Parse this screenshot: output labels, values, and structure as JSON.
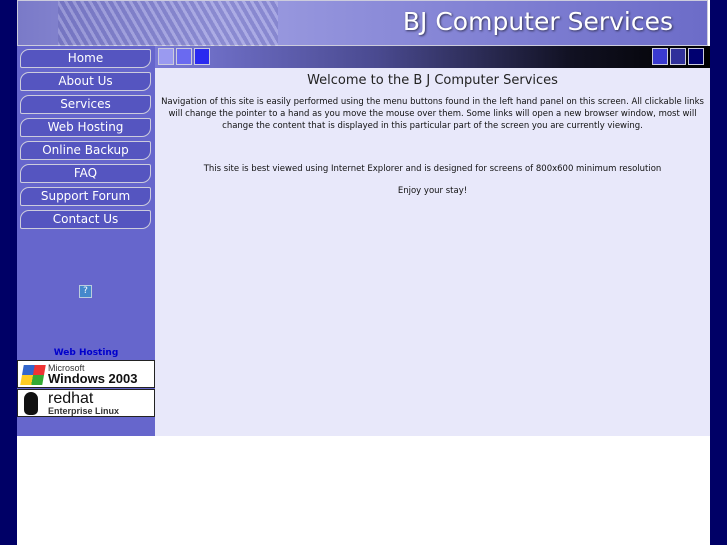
{
  "header": {
    "site_title": "BJ Computer Services"
  },
  "sidebar": {
    "nav": [
      {
        "label": "Home"
      },
      {
        "label": "About Us"
      },
      {
        "label": "Services"
      },
      {
        "label": "Web Hosting"
      },
      {
        "label": "Online Backup"
      },
      {
        "label": "FAQ"
      },
      {
        "label": "Support Forum"
      },
      {
        "label": "Contact Us"
      }
    ],
    "help_icon": "?",
    "web_hosting_label": "Web Hosting",
    "windows_badge": {
      "line1": "Microsoft",
      "line2": "Windows 2003"
    },
    "redhat_badge": {
      "line1": "redhat",
      "line2": "Enterprise Linux"
    }
  },
  "colors": {
    "background": "#000066",
    "sidebar": "#6666cc",
    "content": "#e8e8fa"
  },
  "main": {
    "title": "Welcome to the B J Computer Services",
    "intro": "Navigation of this site is easily performed using the menu buttons found in the left hand panel on this screen. All clickable links will change the pointer to a hand as you move the mouse over them. Some links will open a new browser window, most will change the content that is displayed in this particular part of the screen you are currently viewing.",
    "browser_note": "This site is best viewed using Internet Explorer and is designed for screens of 800x600 minimum resolution",
    "closing": "Enjoy your stay!"
  }
}
